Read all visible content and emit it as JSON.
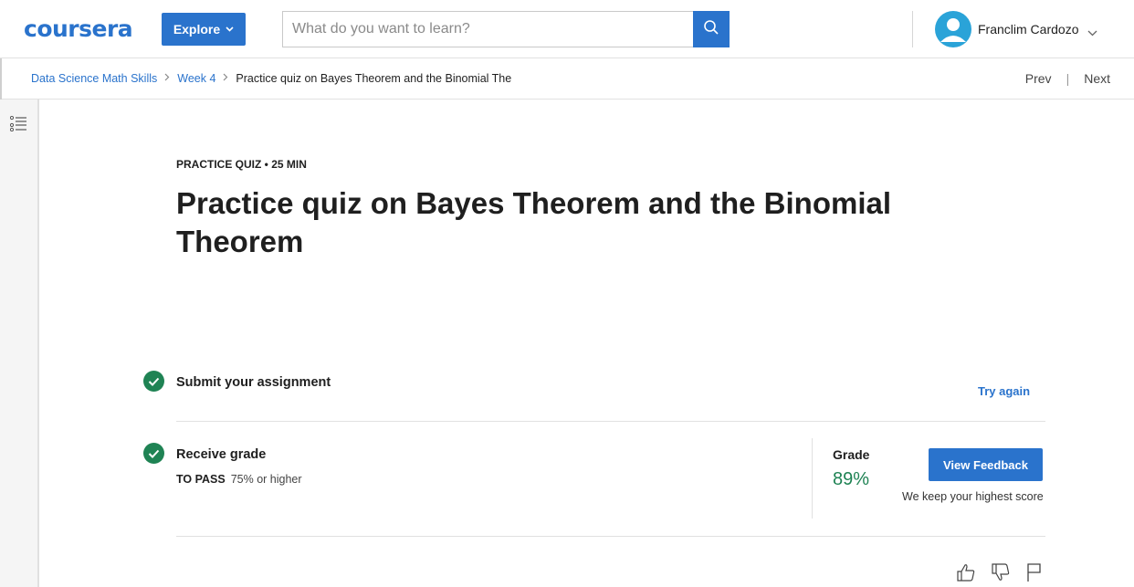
{
  "header": {
    "logo": "coursera",
    "explore_label": "Explore",
    "search": {
      "placeholder": "What do you want to learn?",
      "value": ""
    },
    "user_name": "Franclim Cardozo"
  },
  "breadcrumb": {
    "items": [
      "Data Science Math Skills",
      "Week 4"
    ],
    "current": "Practice quiz on Bayes Theorem and the Binomial The"
  },
  "nav": {
    "prev_label": "Prev",
    "next_label": "Next"
  },
  "quiz": {
    "kicker": "PRACTICE QUIZ • 25 MIN",
    "title": "Practice quiz on Bayes Theorem and the Binomial Theorem"
  },
  "steps": {
    "submit": {
      "title": "Submit your assignment",
      "action_label": "Try again"
    },
    "grade": {
      "title": "Receive grade",
      "pass_label": "TO PASS",
      "pass_value": "75% or higher",
      "grade_label": "Grade",
      "grade_value": "89%",
      "feedback_label": "View Feedback",
      "keep_note": "We keep your highest score"
    }
  },
  "colors": {
    "brand": "#2a73cc",
    "success": "#1f8354"
  },
  "icons": [
    "search-icon",
    "user-avatar-icon",
    "chevron-down-icon",
    "list-menu-icon",
    "check-icon",
    "thumbs-up-icon",
    "thumbs-down-icon",
    "flag-icon"
  ]
}
